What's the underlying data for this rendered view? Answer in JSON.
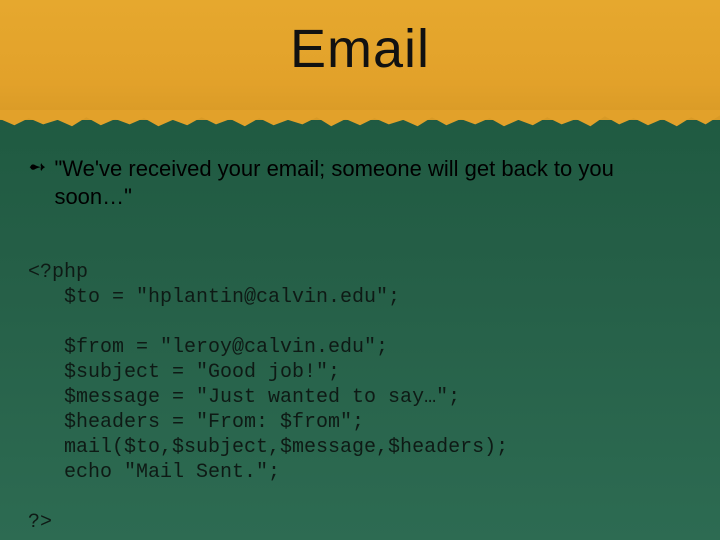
{
  "title": "Email",
  "bullet": {
    "mark": "➻",
    "text": "\"We've received your email; someone will get back to you soon…\""
  },
  "code": {
    "l1": "<?php",
    "l2": "   $to = \"hplantin@calvin.edu\";",
    "l3": "",
    "l4": "   $from = \"leroy@calvin.edu\";",
    "l5": "   $subject = \"Good job!\";",
    "l6": "   $message = \"Just wanted to say…\";",
    "l7": "   $headers = \"From: $from\";",
    "l8": "   mail($to,$subject,$message,$headers);",
    "l9": "   echo \"Mail Sent.\";",
    "l10": "",
    "l11": "?>"
  }
}
